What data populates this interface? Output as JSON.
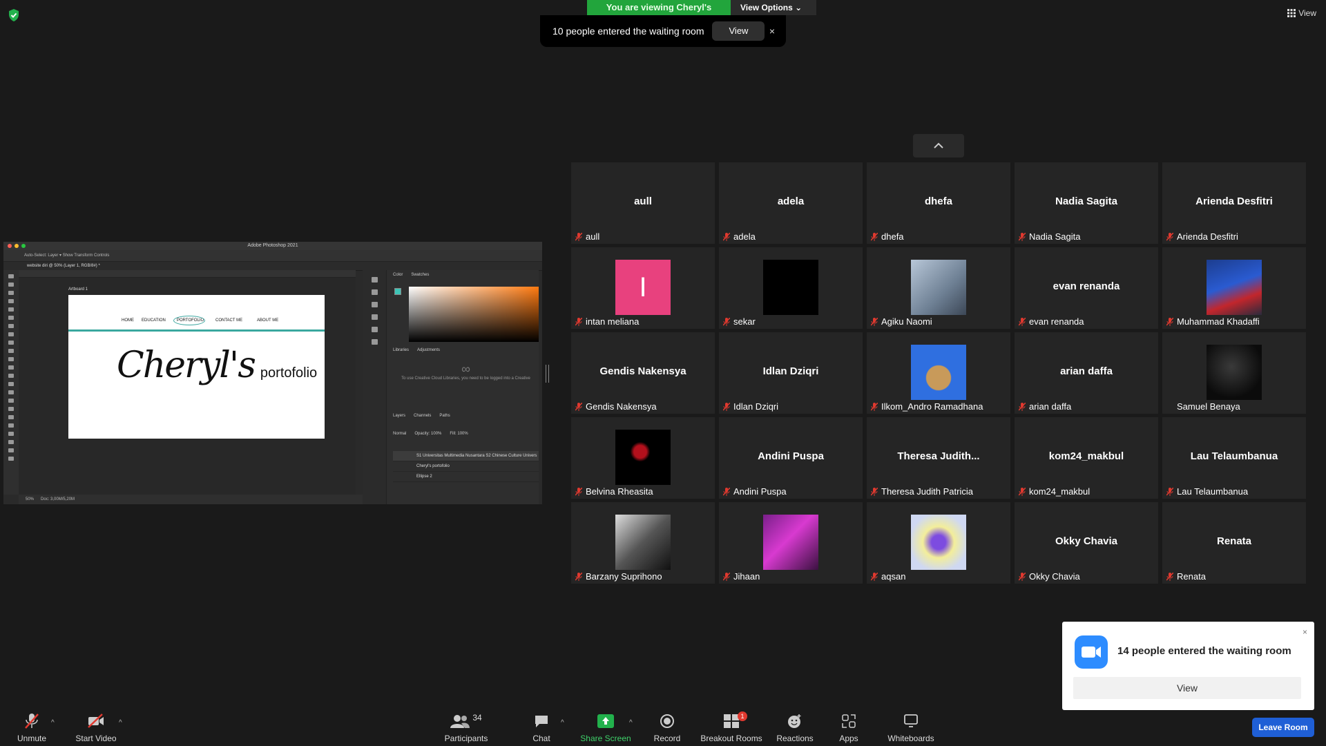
{
  "banner": {
    "viewing": "You are viewing Cheryl's screen",
    "view_options": "View Options",
    "waiting_msg": "10 people entered the waiting room",
    "waiting_view": "View",
    "waiting_close": "×"
  },
  "top_view_label": "View",
  "photoshop": {
    "app_title": "Adobe Photoshop 2021",
    "tab_title": "website diri @ 50% (Layer 1, RGB/8#) *",
    "options_bar": "Auto-Select:  Layer  ▾   Show Transform Controls",
    "artboard_label": "Artboard 1",
    "nav": [
      "HOME",
      "EDUCATION",
      "PORTOFOLIO",
      "CONTACT ME",
      "ABOUT ME"
    ],
    "headline_script": "Cheryl's",
    "headline_plain": "portofolio",
    "panel_tabs_top": [
      "Color",
      "Swatches"
    ],
    "panel_tabs_mid": [
      "Libraries",
      "Adjustments"
    ],
    "panel_tabs_bottom": [
      "Layers",
      "Channels",
      "Paths"
    ],
    "libraries_msg": "To use Creative Cloud Libraries, you need to be logged into a Creative",
    "blend_mode": "Normal",
    "opacity": "Opacity: 100%",
    "fill": "Fill: 100%",
    "layers": [
      "S1 Universitas Multimedia Nusantara S2 Chinese Culture Univers",
      "Cheryl's portofolio",
      "Ellipse 2"
    ],
    "zoom": "50%",
    "doc_info": "Doc: 3,00M/5,20M"
  },
  "tiles": [
    {
      "center": "aull",
      "name": "aull"
    },
    {
      "center": "adela",
      "name": "adela"
    },
    {
      "center": "dhefa",
      "name": "dhefa"
    },
    {
      "center": "Nadia Sagita",
      "name": "Nadia Sagita"
    },
    {
      "center": "Arienda Desfitri",
      "name": "Arienda Desfitri"
    },
    {
      "center": "",
      "name": "intan meliana",
      "avatar": "pink-letter",
      "letter": "I"
    },
    {
      "center": "",
      "name": "sekar",
      "avatar": "black"
    },
    {
      "center": "",
      "name": "Agiku Naomi",
      "avatar": "photo-girl"
    },
    {
      "center": "evan renanda",
      "name": "evan renanda"
    },
    {
      "center": "",
      "name": "Muhammad Khadaffi",
      "avatar": "photo-basketball"
    },
    {
      "center": "Gendis Nakensya",
      "name": "Gendis Nakensya"
    },
    {
      "center": "Idlan Dziqri",
      "name": "Idlan Dziqri"
    },
    {
      "center": "",
      "name": "Ilkom_Andro Ramadhana",
      "avatar": "photo-dog"
    },
    {
      "center": "arian daffa",
      "name": "arian daffa"
    },
    {
      "center": "",
      "name": "Samuel Benaya",
      "avatar": "photo-dark"
    },
    {
      "center": "",
      "name": "Belvina Rheasita",
      "avatar": "photo-rose"
    },
    {
      "center": "Andini Puspa",
      "name": "Andini Puspa"
    },
    {
      "center": "Theresa  Judith...",
      "name": "Theresa Judith Patricia"
    },
    {
      "center": "kom24_makbul",
      "name": "kom24_makbul"
    },
    {
      "center": "Lau Telaumbanua",
      "name": "Lau Telaumbanua"
    },
    {
      "center": "",
      "name": "Barzany Suprihono",
      "avatar": "photo-bw"
    },
    {
      "center": "",
      "name": "Jihaan",
      "avatar": "photo-purple"
    },
    {
      "center": "",
      "name": "aqsan",
      "avatar": "photo-heart"
    },
    {
      "center": "Okky Chavia",
      "name": "Okky Chavia"
    },
    {
      "center": "Renata",
      "name": "Renata"
    }
  ],
  "popup": {
    "message": "14 people entered the waiting room",
    "view": "View",
    "close": "×"
  },
  "toolbar": {
    "unmute": "Unmute",
    "start_video": "Start Video",
    "participants": "Participants",
    "participants_count": "34",
    "chat": "Chat",
    "share_screen": "Share Screen",
    "record": "Record",
    "breakout": "Breakout Rooms",
    "breakout_badge": "1",
    "reactions": "Reactions",
    "apps": "Apps",
    "whiteboards": "Whiteboards",
    "leave": "Leave Room"
  },
  "colors": {
    "accent_green": "#22a53c",
    "leave_blue": "#1f5fd6",
    "mute_red": "#e0392f",
    "zoom_blue": "#2d8cff"
  }
}
